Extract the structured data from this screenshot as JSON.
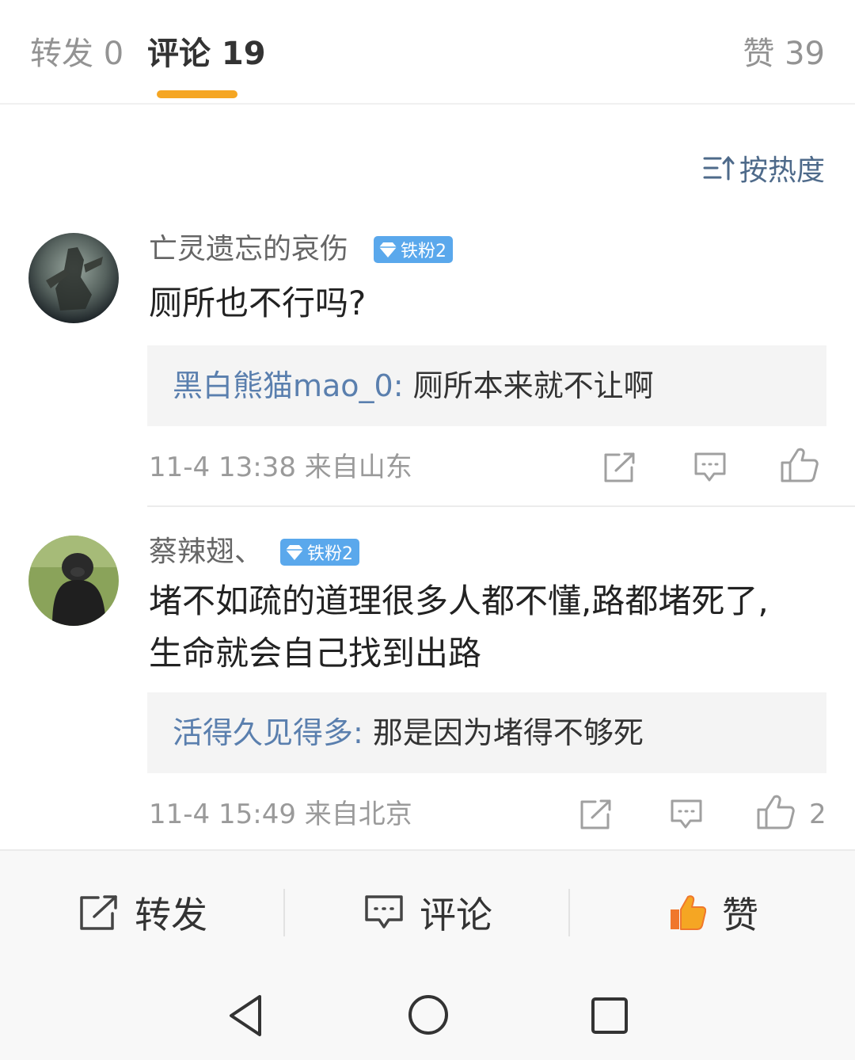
{
  "tabs": {
    "repost_label": "转发 0",
    "comment_label": "评论 19",
    "likes_label": "赞 39"
  },
  "sort": {
    "label": "按热度",
    "icon": "sort-icon"
  },
  "comments": [
    {
      "username": "亡灵遗忘的哀伤",
      "badge": "铁粉2",
      "text": "厕所也不行吗?",
      "reply_user": "黑白熊猫mao_0",
      "reply_text": "厕所本来就不让啊",
      "time": "11-4 13:38",
      "location": "来自山东",
      "likes": ""
    },
    {
      "username": "蔡辣翅、",
      "badge": "铁粉2",
      "text_line1": "堵不如疏的道理很多人都不懂,路都堵死了,",
      "text_line2": "生命就会自己找到出路",
      "reply_user": "活得久见得多",
      "reply_text": "那是因为堵得不够死",
      "time": "11-4 15:49",
      "location": "来自北京",
      "likes": "2"
    }
  ],
  "reply_colon": ":",
  "bottom_bar": {
    "repost": "转发",
    "comment": "评论",
    "like": "赞"
  },
  "colors": {
    "accent": "#f5a623",
    "link": "#5a7fae",
    "badge": "#5aa8ec",
    "like_active": "#f0772c"
  }
}
